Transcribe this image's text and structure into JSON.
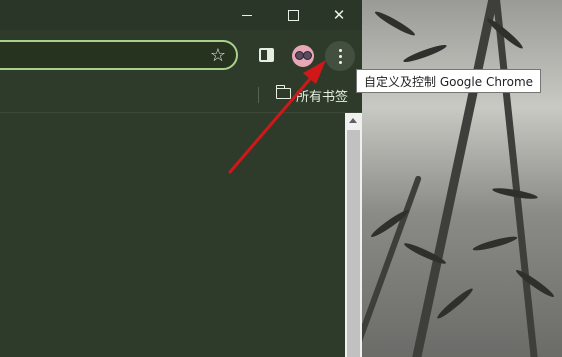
{
  "window": {
    "minimize_icon": "minimize-icon",
    "maximize_icon": "maximize-icon",
    "close_glyph": "✕"
  },
  "toolbar": {
    "star_glyph": "☆",
    "menu_tooltip": "自定义及控制 Google Chrome"
  },
  "bookmarks_bar": {
    "all_bookmarks_label": "所有书签"
  },
  "annotation": {
    "arrow_color": "#d01818"
  },
  "colors": {
    "accent_green": "#a9d18e",
    "frame_bg": "#2e3b2b"
  }
}
